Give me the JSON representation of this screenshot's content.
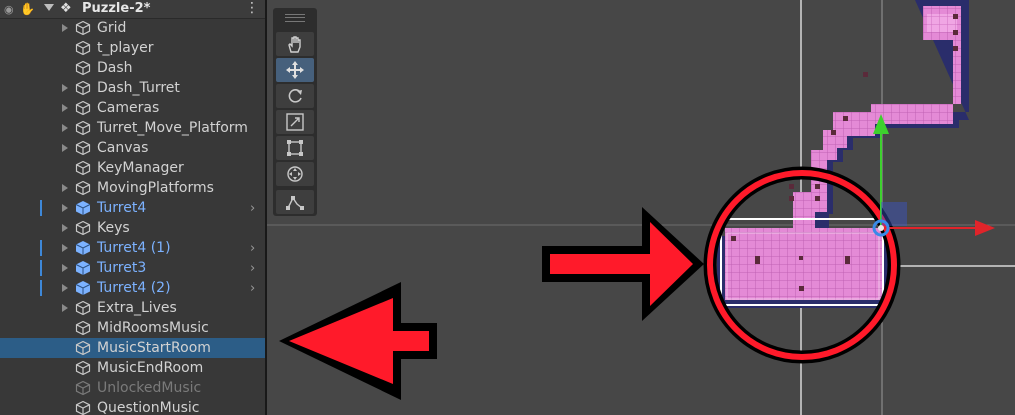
{
  "hierarchy": {
    "scene_name": "Puzzle-2*",
    "items": [
      {
        "label": "Grid",
        "expandable": true,
        "prefab": false,
        "has_chevron": false,
        "selected": false,
        "disabled": false,
        "marker": false
      },
      {
        "label": "t_player",
        "expandable": false,
        "prefab": false,
        "has_chevron": false,
        "selected": false,
        "disabled": false,
        "marker": false
      },
      {
        "label": "Dash",
        "expandable": false,
        "prefab": false,
        "has_chevron": false,
        "selected": false,
        "disabled": false,
        "marker": false
      },
      {
        "label": "Dash_Turret",
        "expandable": true,
        "prefab": false,
        "has_chevron": false,
        "selected": false,
        "disabled": false,
        "marker": false
      },
      {
        "label": "Cameras",
        "expandable": true,
        "prefab": false,
        "has_chevron": false,
        "selected": false,
        "disabled": false,
        "marker": false
      },
      {
        "label": "Turret_Move_Platform",
        "expandable": true,
        "prefab": false,
        "has_chevron": false,
        "selected": false,
        "disabled": false,
        "marker": false
      },
      {
        "label": "Canvas",
        "expandable": true,
        "prefab": false,
        "has_chevron": false,
        "selected": false,
        "disabled": false,
        "marker": false
      },
      {
        "label": "KeyManager",
        "expandable": false,
        "prefab": false,
        "has_chevron": false,
        "selected": false,
        "disabled": false,
        "marker": false
      },
      {
        "label": "MovingPlatforms",
        "expandable": true,
        "prefab": false,
        "has_chevron": false,
        "selected": false,
        "disabled": false,
        "marker": false
      },
      {
        "label": "Turret4",
        "expandable": true,
        "prefab": true,
        "has_chevron": true,
        "selected": false,
        "disabled": false,
        "marker": true
      },
      {
        "label": "Keys",
        "expandable": true,
        "prefab": false,
        "has_chevron": false,
        "selected": false,
        "disabled": false,
        "marker": false
      },
      {
        "label": "Turret4 (1)",
        "expandable": true,
        "prefab": true,
        "has_chevron": true,
        "selected": false,
        "disabled": false,
        "marker": true
      },
      {
        "label": "Turret3",
        "expandable": true,
        "prefab": true,
        "has_chevron": true,
        "selected": false,
        "disabled": false,
        "marker": true
      },
      {
        "label": "Turret4 (2)",
        "expandable": true,
        "prefab": true,
        "has_chevron": true,
        "selected": false,
        "disabled": false,
        "marker": true
      },
      {
        "label": "Extra_Lives",
        "expandable": true,
        "prefab": false,
        "has_chevron": false,
        "selected": false,
        "disabled": false,
        "marker": false
      },
      {
        "label": "MidRoomsMusic",
        "expandable": false,
        "prefab": false,
        "has_chevron": false,
        "selected": false,
        "disabled": false,
        "marker": false
      },
      {
        "label": "MusicStartRoom",
        "expandable": false,
        "prefab": false,
        "has_chevron": false,
        "selected": true,
        "disabled": false,
        "marker": false
      },
      {
        "label": "MusicEndRoom",
        "expandable": false,
        "prefab": false,
        "has_chevron": false,
        "selected": false,
        "disabled": false,
        "marker": false
      },
      {
        "label": "UnlockedMusic",
        "expandable": false,
        "prefab": false,
        "has_chevron": false,
        "selected": false,
        "disabled": true,
        "marker": false
      },
      {
        "label": "QuestionMusic",
        "expandable": false,
        "prefab": false,
        "has_chevron": false,
        "selected": false,
        "disabled": false,
        "marker": false
      }
    ]
  },
  "toolbar": {
    "tools": [
      {
        "name": "hand-tool",
        "icon": "hand-icon",
        "active": false
      },
      {
        "name": "move-tool",
        "icon": "move-arrows-icon",
        "active": true
      },
      {
        "name": "rotate-tool",
        "icon": "rotate-icon",
        "active": false
      },
      {
        "name": "scale-tool",
        "icon": "scale-icon",
        "active": false
      },
      {
        "name": "rect-tool",
        "icon": "rect-transform-icon",
        "active": false
      },
      {
        "name": "transform-tool",
        "icon": "transform-icon",
        "active": false
      },
      {
        "name": "custom-editor-tool",
        "icon": "custom-tool-icon",
        "active": false
      }
    ]
  },
  "colors": {
    "panel_bg": "#383838",
    "scene_bg": "#474747",
    "selection": "#2c5d87",
    "prefab_text": "#7cb2ff",
    "annotation_red": "#ff1a2a",
    "tile_pink": "#e48ad6",
    "tile_border": "#2a2d6b",
    "gizmo_x": "#e0242a",
    "gizmo_y": "#3ed12e"
  }
}
